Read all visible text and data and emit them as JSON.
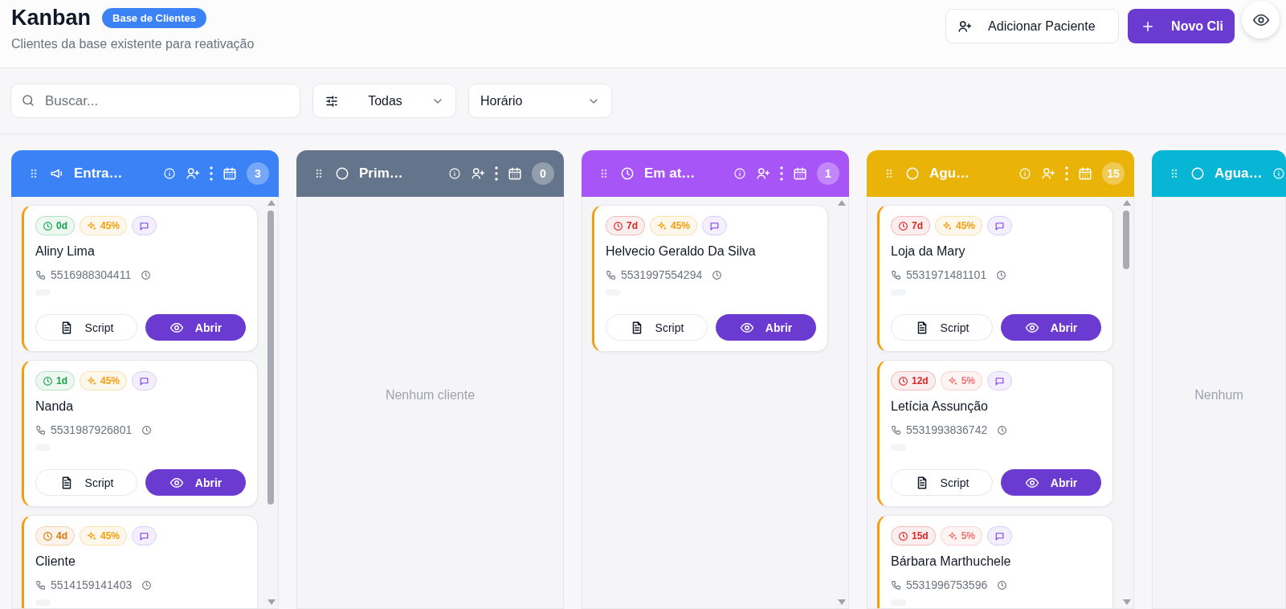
{
  "header": {
    "title": "Kanban",
    "badge": "Base de Clientes",
    "subtitle": "Clientes da base existente para reativação",
    "actions": [
      {
        "kind": "outline",
        "label": "Adicionar Paciente"
      },
      {
        "kind": "primary",
        "label": "Novo Cli"
      }
    ]
  },
  "toolbar": {
    "search": {
      "placeholder": "Buscar..."
    },
    "filters": [
      {
        "kind": "tune",
        "value": "Todas"
      },
      {
        "kind": "plain",
        "value": "Horário"
      }
    ]
  },
  "columns": [
    {
      "kind": "entry",
      "title": "Entra…",
      "color": "#3b82f6",
      "count": "3",
      "cards": [
        {
          "age": {
            "text": "0d",
            "color": "#16a34a"
          },
          "score": {
            "text": "45%",
            "color": "#f59e0b"
          },
          "name": "Aliny Lima",
          "phone": "5516988304411",
          "actions": [
            "Script",
            "Abrir"
          ]
        },
        {
          "age": {
            "text": "1d",
            "color": "#16a34a"
          },
          "score": {
            "text": "45%",
            "color": "#f59e0b"
          },
          "name": "Nanda",
          "phone": "5531987926801",
          "actions": [
            "Script",
            "Abrir"
          ]
        },
        {
          "age": {
            "text": "4d",
            "color": "#d97706"
          },
          "score": {
            "text": "45%",
            "color": "#f59e0b"
          },
          "name": "Cliente",
          "phone": "5514159141403"
        }
      ]
    },
    {
      "kind": "stage",
      "title": "Prim…",
      "color": "#64748b",
      "count": "0",
      "empty": "Nenhum cliente"
    },
    {
      "kind": "active",
      "title": "Em at…",
      "color": "#a855f7",
      "count": "1",
      "cards": [
        {
          "age": {
            "text": "7d",
            "color": "#dc2626"
          },
          "score": {
            "text": "45%",
            "color": "#f59e0b"
          },
          "name": "Helvecio Geraldo Da Silva",
          "phone": "5531997554294",
          "actions": [
            "Script",
            "Abrir"
          ]
        }
      ]
    },
    {
      "kind": "stage",
      "title": "Agu…",
      "color": "#eab308",
      "count": "15",
      "cards": [
        {
          "age": {
            "text": "7d",
            "color": "#dc2626"
          },
          "score": {
            "text": "45%",
            "color": "#f59e0b"
          },
          "name": "Loja da Mary",
          "phone": "5531971481101",
          "actions": [
            "Script",
            "Abrir"
          ]
        },
        {
          "age": {
            "text": "12d",
            "color": "#dc2626"
          },
          "score": {
            "text": "5%",
            "color": "#f87171"
          },
          "name": "Letícia Assunção",
          "phone": "5531993836742",
          "actions": [
            "Script",
            "Abrir"
          ]
        },
        {
          "age": {
            "text": "15d",
            "color": "#dc2626"
          },
          "score": {
            "text": "5%",
            "color": "#f87171"
          },
          "name": "Bárbara Marthuchele",
          "phone": "5531996753596"
        }
      ]
    },
    {
      "kind": "stage",
      "title": "Agua…",
      "color": "#06b6d4",
      "empty": "Nenhum"
    }
  ]
}
